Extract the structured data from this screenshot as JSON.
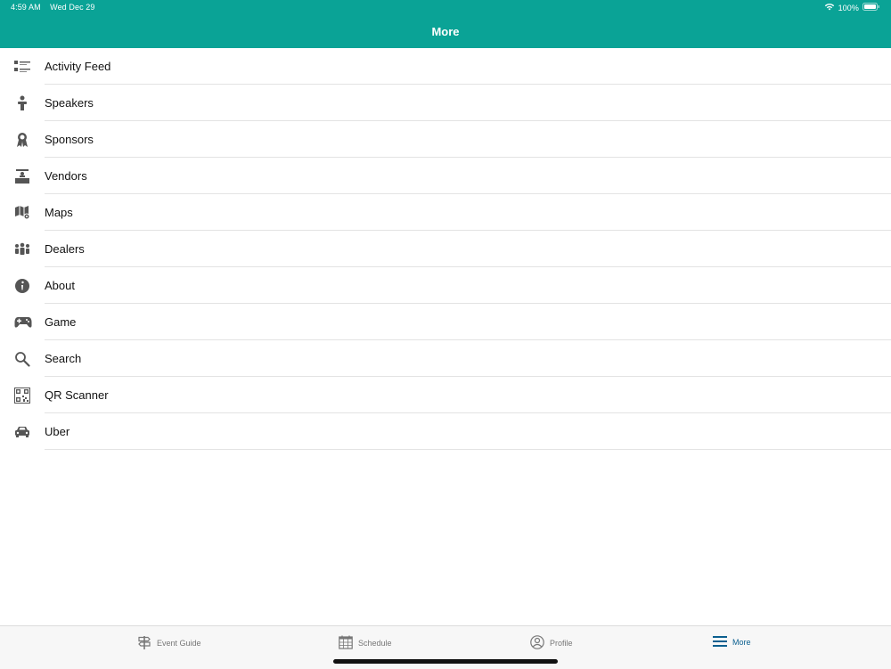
{
  "status_bar": {
    "time": "4:59 AM",
    "date": "Wed Dec 29",
    "battery_text": "100%"
  },
  "header": {
    "title": "More"
  },
  "menu": {
    "items": [
      {
        "label": "Activity Feed",
        "icon": "activity-feed-icon"
      },
      {
        "label": "Speakers",
        "icon": "speaker-icon"
      },
      {
        "label": "Sponsors",
        "icon": "sponsor-ribbon-icon"
      },
      {
        "label": "Vendors",
        "icon": "vendor-booth-icon"
      },
      {
        "label": "Maps",
        "icon": "map-icon"
      },
      {
        "label": "Dealers",
        "icon": "people-group-icon"
      },
      {
        "label": "About",
        "icon": "info-icon"
      },
      {
        "label": "Game",
        "icon": "gamepad-icon"
      },
      {
        "label": "Search",
        "icon": "search-icon"
      },
      {
        "label": "QR Scanner",
        "icon": "qr-code-icon"
      },
      {
        "label": "Uber",
        "icon": "car-icon"
      }
    ]
  },
  "tabs": [
    {
      "label": "Event Guide",
      "icon": "signpost-icon",
      "active": false
    },
    {
      "label": "Schedule",
      "icon": "calendar-icon",
      "active": false
    },
    {
      "label": "Profile",
      "icon": "profile-icon",
      "active": false
    },
    {
      "label": "More",
      "icon": "hamburger-menu-icon",
      "active": true
    }
  ],
  "colors": {
    "header": "#0aa396",
    "active_tab": "#0b5f8f",
    "icon": "#555555"
  }
}
